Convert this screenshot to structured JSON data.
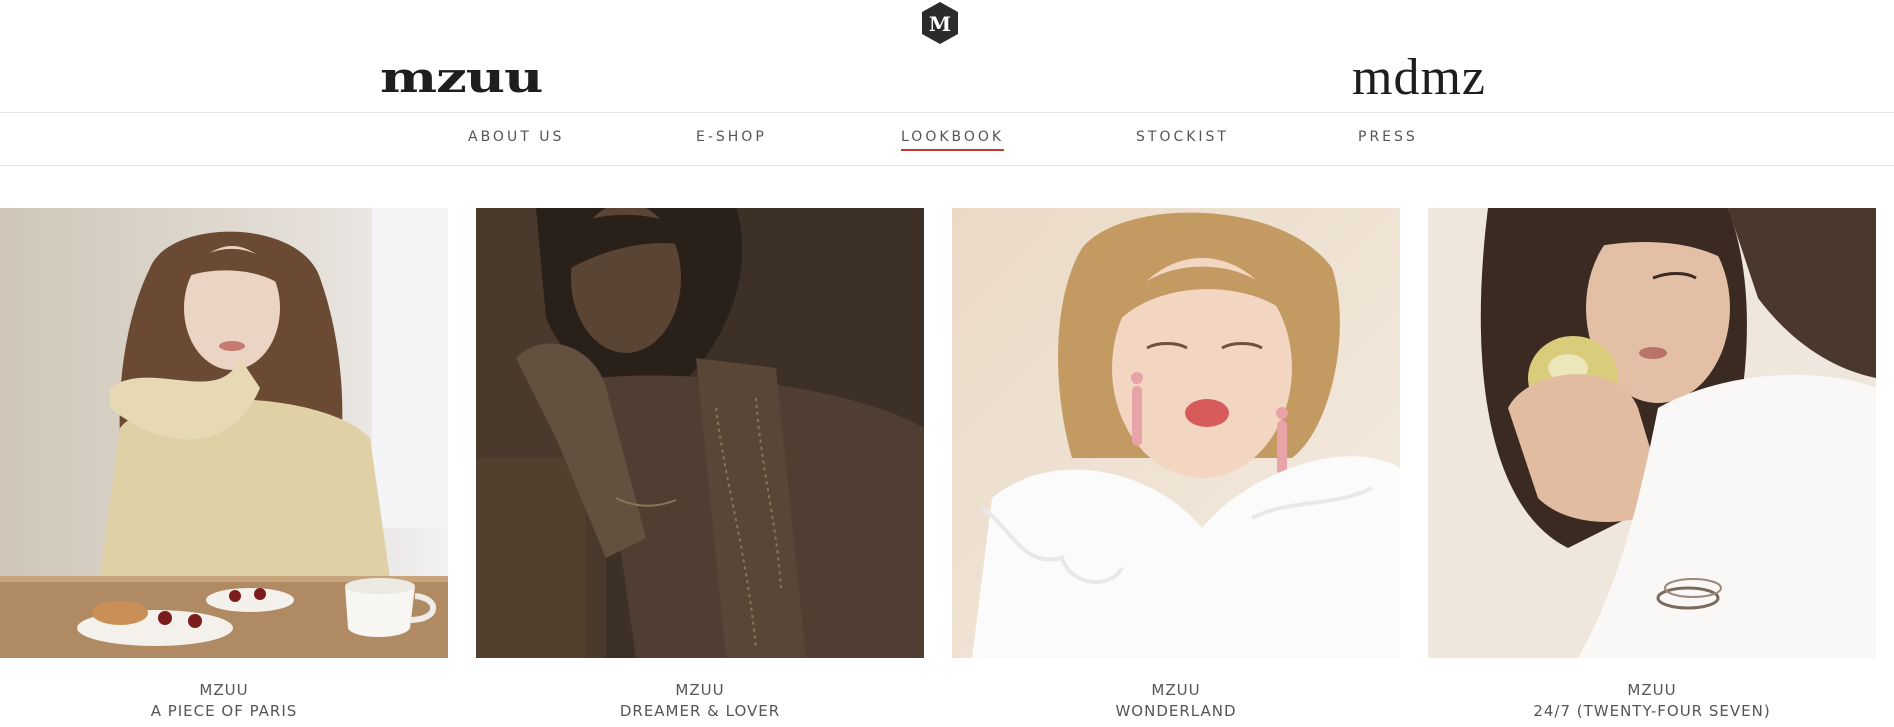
{
  "header": {
    "top_logo_letter": "M",
    "brands": [
      {
        "label": "mzuu"
      },
      {
        "label": "mdmz"
      }
    ]
  },
  "nav": {
    "items": [
      {
        "label": "ABOUT US",
        "active": false
      },
      {
        "label": "E-SHOP",
        "active": false
      },
      {
        "label": "LOOKBOOK",
        "active": true
      },
      {
        "label": "STOCKIST",
        "active": false
      },
      {
        "label": "PRESS",
        "active": false
      }
    ],
    "active_color": "#c0392b"
  },
  "lookbooks": [
    {
      "brand": "MZUU",
      "title": "A PIECE OF PARIS"
    },
    {
      "brand": "MZUU",
      "title": "DREAMER & LOVER"
    },
    {
      "brand": "MZUU",
      "title": "WONDERLAND"
    },
    {
      "brand": "MZUU",
      "title": "24/7 (TWENTY-FOUR SEVEN)"
    }
  ]
}
